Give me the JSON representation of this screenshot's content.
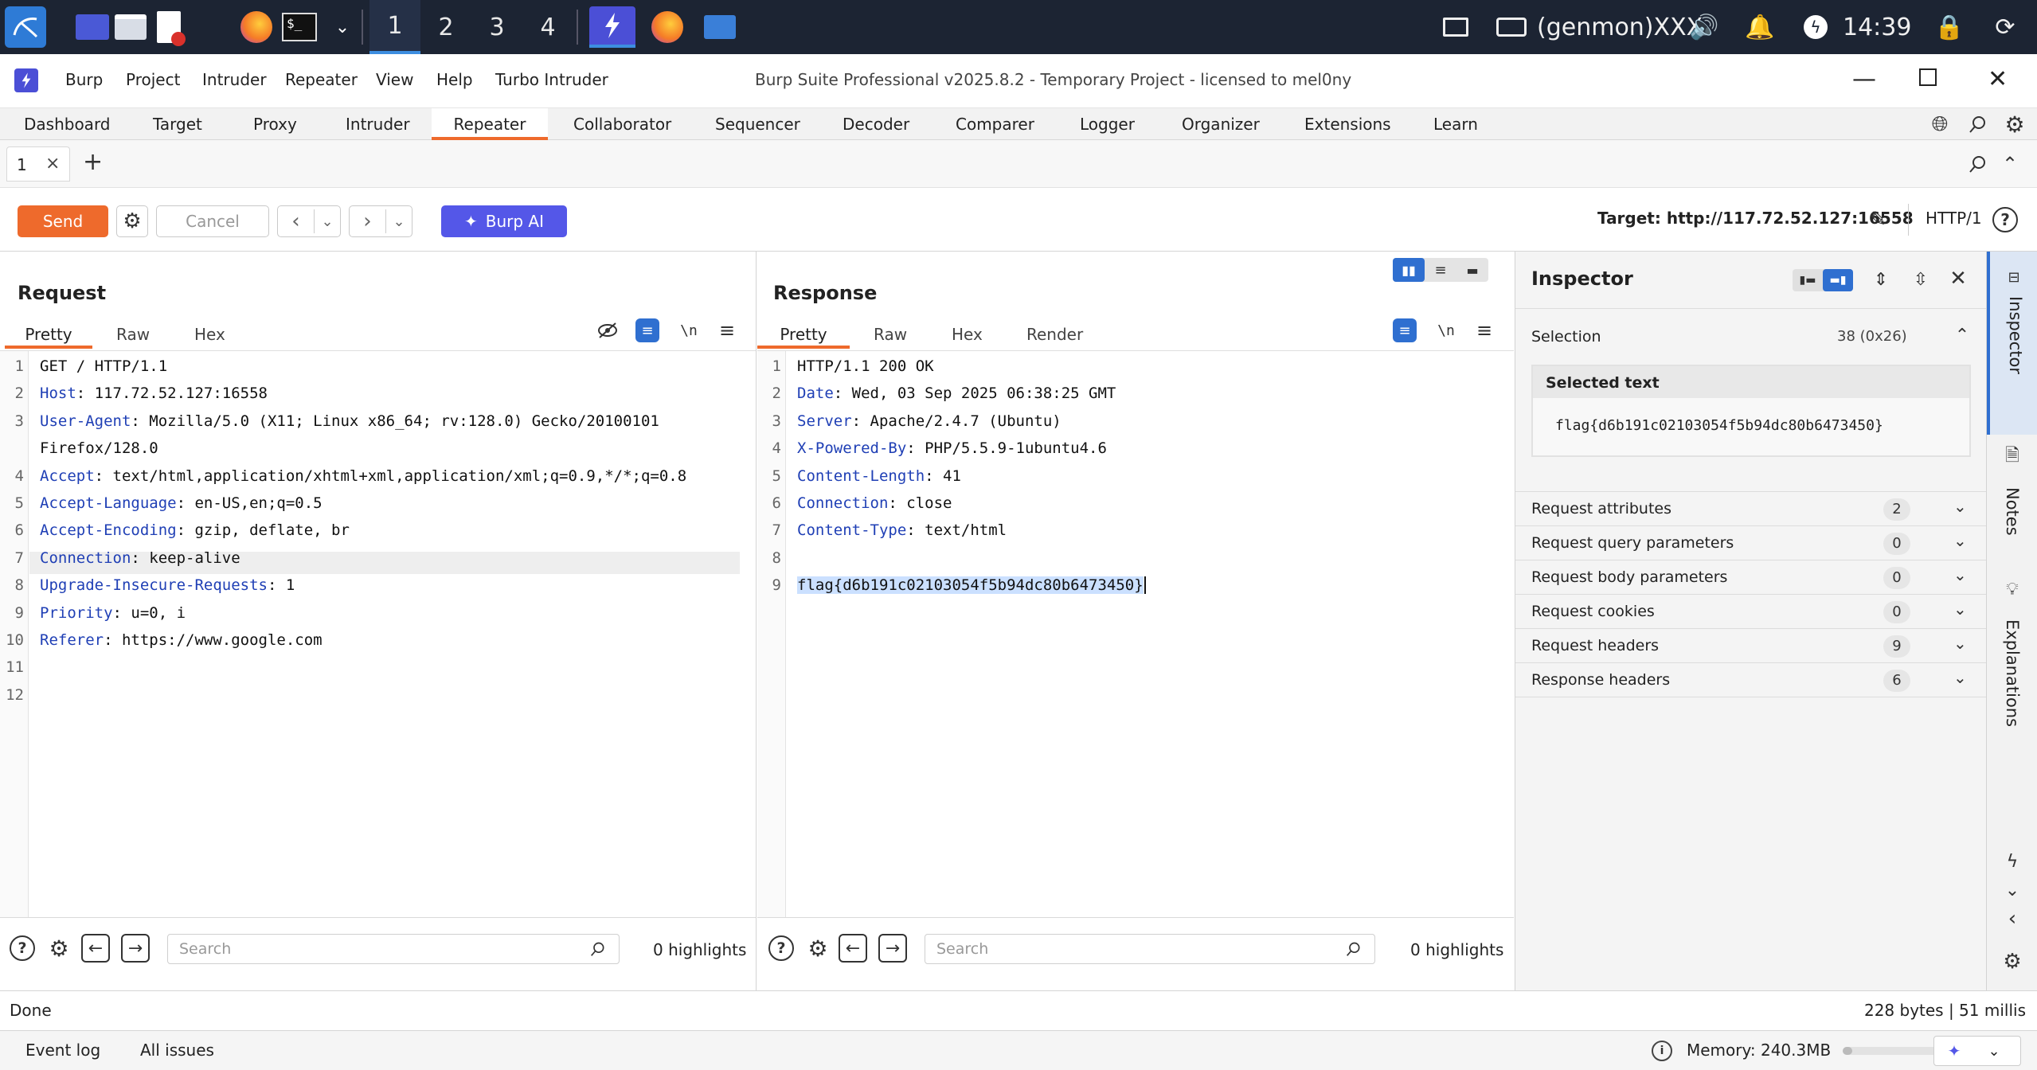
{
  "taskbar": {
    "workspaces": [
      "1",
      "2",
      "3",
      "4"
    ],
    "genmon": "(genmon)XXX",
    "clock": "14:39"
  },
  "menubar": {
    "items": [
      "Burp",
      "Project",
      "Intruder",
      "Repeater",
      "View",
      "Help",
      "Turbo Intruder"
    ],
    "window_title": "Burp Suite Professional v2025.8.2 - Temporary Project - licensed to mel0ny"
  },
  "main_tabs": [
    "Dashboard",
    "Target",
    "Proxy",
    "Intruder",
    "Repeater",
    "Collaborator",
    "Sequencer",
    "Decoder",
    "Comparer",
    "Logger",
    "Organizer",
    "Extensions",
    "Learn"
  ],
  "active_main_tab": "Repeater",
  "repeater_tab": {
    "label": "1",
    "close": "×",
    "add": "+"
  },
  "toolbar": {
    "send": "Send",
    "cancel": "Cancel",
    "burp_ai": "Burp AI",
    "target": "Target: http://117.72.52.127:16558",
    "protocol": "HTTP/1"
  },
  "request": {
    "title": "Request",
    "tabs": [
      "Pretty",
      "Raw",
      "Hex"
    ],
    "lines": [
      {
        "n": "1",
        "key": "",
        "val": "GET / HTTP/1.1"
      },
      {
        "n": "2",
        "key": "Host",
        "val": ": 117.72.52.127:16558"
      },
      {
        "n": "3",
        "key": "User-Agent",
        "val": ": Mozilla/5.0 (X11; Linux x86_64; rv:128.0) Gecko/20100101"
      },
      {
        "n": "",
        "key": "",
        "val": "Firefox/128.0"
      },
      {
        "n": "4",
        "key": "Accept",
        "val": ": text/html,application/xhtml+xml,application/xml;q=0.9,*/*;q=0.8"
      },
      {
        "n": "5",
        "key": "Accept-Language",
        "val": ": en-US,en;q=0.5"
      },
      {
        "n": "6",
        "key": "Accept-Encoding",
        "val": ": gzip, deflate, br"
      },
      {
        "n": "7",
        "key": "Connection",
        "val": ": keep-alive"
      },
      {
        "n": "8",
        "key": "Upgrade-Insecure-Requests",
        "val": ": 1"
      },
      {
        "n": "9",
        "key": "Priority",
        "val": ": u=0, i"
      },
      {
        "n": "10",
        "key": "Referer",
        "val": ": https://www.google.com"
      },
      {
        "n": "11",
        "key": "",
        "val": ""
      },
      {
        "n": "12",
        "key": "",
        "val": ""
      }
    ],
    "search_placeholder": "Search",
    "highlights": "0 highlights"
  },
  "response": {
    "title": "Response",
    "tabs": [
      "Pretty",
      "Raw",
      "Hex",
      "Render"
    ],
    "lines": [
      {
        "n": "1",
        "key": "",
        "val": "HTTP/1.1 200 OK"
      },
      {
        "n": "2",
        "key": "Date",
        "val": ": Wed, 03 Sep 2025 06:38:25 GMT"
      },
      {
        "n": "3",
        "key": "Server",
        "val": ": Apache/2.4.7 (Ubuntu)"
      },
      {
        "n": "4",
        "key": "X-Powered-By",
        "val": ": PHP/5.5.9-1ubuntu4.6"
      },
      {
        "n": "5",
        "key": "Content-Length",
        "val": ": 41"
      },
      {
        "n": "6",
        "key": "Connection",
        "val": ": close"
      },
      {
        "n": "7",
        "key": "Content-Type",
        "val": ": text/html"
      },
      {
        "n": "8",
        "key": "",
        "val": ""
      },
      {
        "n": "9",
        "key": "",
        "val": "flag{d6b191c02103054f5b94dc80b6473450}"
      }
    ],
    "search_placeholder": "Search",
    "highlights": "0 highlights"
  },
  "inspector": {
    "title": "Inspector",
    "selection_label": "Selection",
    "selection_value": "38 (0x26)",
    "selected_text_label": "Selected text",
    "selected_text": "flag{d6b191c02103054f5b94dc80b6473450}",
    "rows": [
      {
        "label": "Request attributes",
        "count": "2"
      },
      {
        "label": "Request query parameters",
        "count": "0"
      },
      {
        "label": "Request body parameters",
        "count": "0"
      },
      {
        "label": "Request cookies",
        "count": "0"
      },
      {
        "label": "Request headers",
        "count": "9"
      },
      {
        "label": "Response headers",
        "count": "6"
      }
    ]
  },
  "side_tabs": [
    "Inspector",
    "Notes",
    "Explanations"
  ],
  "status": {
    "left": "Done",
    "right": "228 bytes | 51 millis"
  },
  "footer": {
    "event_log": "Event log",
    "all_issues": "All issues",
    "memory": "Memory: 240.3MB"
  }
}
